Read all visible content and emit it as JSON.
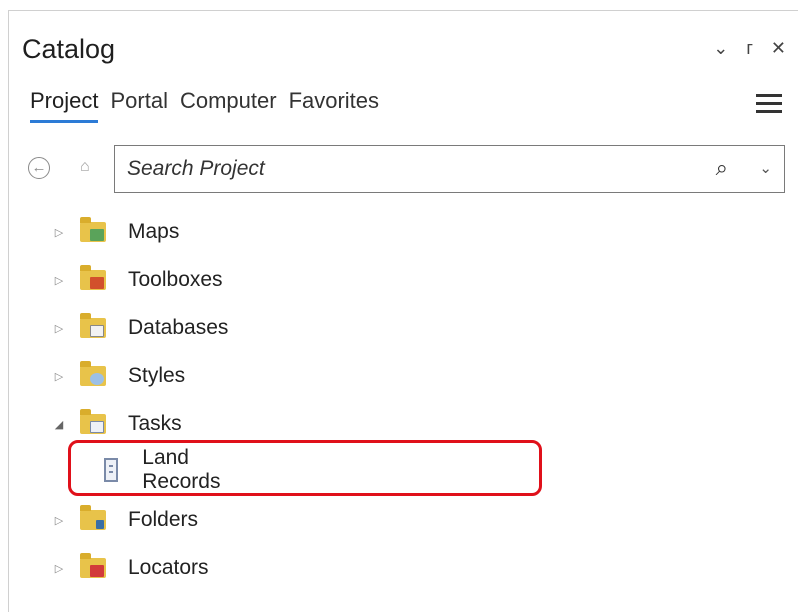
{
  "pane": {
    "title": "Catalog",
    "controls": {
      "dropdown": "⌄",
      "pin": "ᴦ",
      "close": "✕"
    }
  },
  "tabs": [
    {
      "label": "Project",
      "active": true
    },
    {
      "label": "Portal",
      "active": false
    },
    {
      "label": "Computer",
      "active": false
    },
    {
      "label": "Favorites",
      "active": false
    }
  ],
  "search": {
    "placeholder": "Search Project"
  },
  "tree": [
    {
      "label": "Maps",
      "expanded": false,
      "icon": "maps-folder-icon"
    },
    {
      "label": "Toolboxes",
      "expanded": false,
      "icon": "toolboxes-folder-icon"
    },
    {
      "label": "Databases",
      "expanded": false,
      "icon": "databases-folder-icon"
    },
    {
      "label": "Styles",
      "expanded": false,
      "icon": "styles-folder-icon"
    },
    {
      "label": "Tasks",
      "expanded": true,
      "icon": "tasks-folder-icon",
      "children": [
        {
          "label": "Land Records",
          "icon": "task-item-icon"
        }
      ]
    },
    {
      "label": "Folders",
      "expanded": false,
      "icon": "folders-folder-icon"
    },
    {
      "label": "Locators",
      "expanded": false,
      "icon": "locators-folder-icon"
    }
  ],
  "colors": {
    "active_tab_underline": "#2c7bd6",
    "highlight_border": "#e0101a",
    "folder_yellow": "#e8c34a"
  }
}
